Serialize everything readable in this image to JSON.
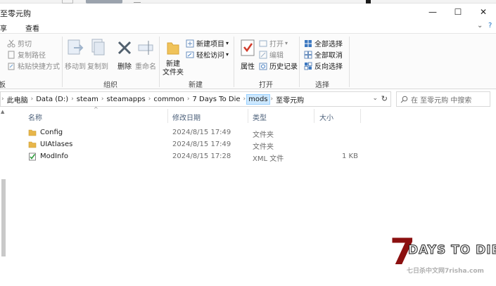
{
  "window": {
    "title": "至零元购",
    "minimize_glyph": "—",
    "maximize_glyph": "☐",
    "close_glyph": "✕"
  },
  "menu": {
    "share": "共享",
    "view": "查看",
    "expand_glyph": "⌄",
    "help_glyph": "?"
  },
  "ribbon": {
    "clipboard": {
      "cut": "剪切",
      "copy_path": "复制路径",
      "paste_shortcut": "粘贴快捷方式"
    },
    "organize": {
      "move_to": "移动到",
      "copy_to": "复制到",
      "delete": "删除",
      "rename": "重命名",
      "group_label": "组织"
    },
    "new": {
      "new_folder": "新建\n文件夹",
      "new_item": "新建项目",
      "easy_access": "轻松访问",
      "group_label": "新建"
    },
    "open": {
      "properties": "属性",
      "open": "打开",
      "edit": "编辑",
      "history": "历史记录",
      "group_label": "打开"
    },
    "select": {
      "select_all": "全部选择",
      "select_none": "全部取消",
      "invert": "反向选择",
      "group_label": "选择"
    },
    "left_cut_label": "板"
  },
  "address": {
    "crumbs": [
      "此电脑",
      "Data (D:)",
      "steam",
      "steamapps",
      "common",
      "7 Days To Die",
      "mods",
      "至零元购"
    ],
    "search_placeholder": "在 至零元购 中搜索"
  },
  "columns": {
    "name": "名称",
    "modified": "修改日期",
    "type": "类型",
    "size": "大小"
  },
  "files": [
    {
      "name": "Config",
      "modified": "2024/8/15 17:49",
      "type": "文件夹",
      "size": "",
      "icon": "folder-icon"
    },
    {
      "name": "UIAtlases",
      "modified": "2024/8/15 17:49",
      "type": "文件夹",
      "size": "",
      "icon": "folder-icon"
    },
    {
      "name": "ModInfo",
      "modified": "2024/8/15 17:28",
      "type": "XML 文件",
      "size": "1 KB",
      "icon": "xml-file-icon"
    }
  ],
  "watermark": {
    "big_digit": "7",
    "text": "DAYS TO DIE",
    "sub": "七日杀中文网7risha.com"
  },
  "colors": {
    "selected_crumb_bg": "#cce8ff",
    "folder": "#e8b64a",
    "logo_red": "#8b1010"
  }
}
